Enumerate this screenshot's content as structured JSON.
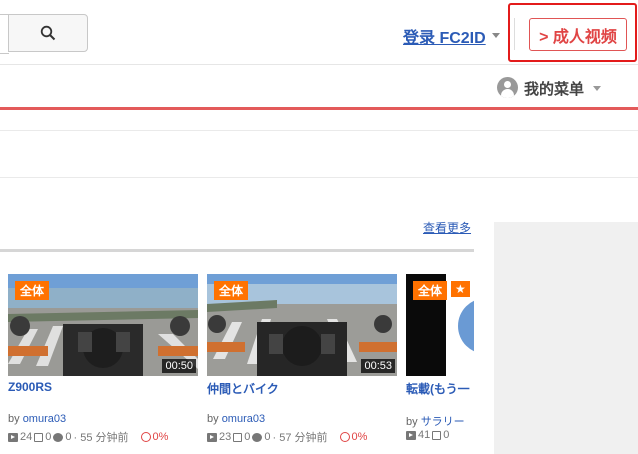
{
  "header": {
    "login_label": "登录 FC2ID",
    "adult_label": "> 成人视频"
  },
  "menu": {
    "my_menu_label": "我的菜单"
  },
  "section": {
    "see_more": "查看更多"
  },
  "videos": [
    {
      "badge": "全体",
      "duration": "00:50",
      "title": "Z900RS",
      "by": "by ",
      "user": "omura03",
      "plays": "24",
      "clips": "0",
      "comments": "0",
      "age": "· 55 分钟前",
      "rating": "0%"
    },
    {
      "badge": "全体",
      "duration": "00:53",
      "title": "仲間とバイク",
      "by": "by ",
      "user": "omura03",
      "plays": "23",
      "clips": "0",
      "comments": "0",
      "age": "· 57 分钟前",
      "rating": "0%"
    },
    {
      "badge": "全体",
      "badge2": "★",
      "title": "転載(もう一",
      "by": "by ",
      "user": "サラリー",
      "plays": "41",
      "clips": "0"
    }
  ],
  "colors": {
    "accent_red": "#e31b1b",
    "link_blue": "#2b5bb6",
    "badge_orange": "#ff7200"
  }
}
